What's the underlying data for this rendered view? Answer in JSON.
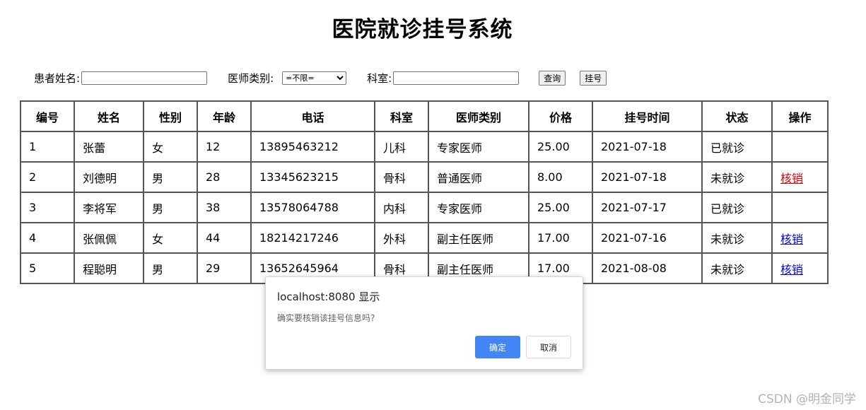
{
  "page": {
    "title": "医院就诊挂号系统"
  },
  "filters": {
    "patient_name_label": "患者姓名:",
    "patient_name_value": "",
    "doctor_type_label": "医师类别:",
    "doctor_type_selected": "=不限=",
    "department_label": "科室:",
    "department_value": "",
    "query_button": "查询",
    "register_button": "挂号"
  },
  "table": {
    "headers": [
      "编号",
      "姓名",
      "性别",
      "年龄",
      "电话",
      "科室",
      "医师类别",
      "价格",
      "挂号时间",
      "状态",
      "操作"
    ],
    "rows": [
      [
        "1",
        "张蕾",
        "女",
        "12",
        "13895463212",
        "儿科",
        "专家医师",
        "25.00",
        "2021-07-18",
        "已就诊",
        ""
      ],
      [
        "2",
        "刘德明",
        "男",
        "28",
        "13345623215",
        "骨科",
        "普通医师",
        "8.00",
        "2021-07-18",
        "未就诊",
        "核销"
      ],
      [
        "3",
        "李将军",
        "男",
        "38",
        "13578064788",
        "内科",
        "专家医师",
        "25.00",
        "2021-07-17",
        "已就诊",
        ""
      ],
      [
        "4",
        "张佩佩",
        "女",
        "44",
        "18214217246",
        "外科",
        "副主任医师",
        "17.00",
        "2021-07-16",
        "未就诊",
        "核销"
      ],
      [
        "5",
        "程聪明",
        "男",
        "29",
        "13652645964",
        "骨科",
        "副主任医师",
        "17.00",
        "2021-08-08",
        "未就诊",
        "核销"
      ]
    ]
  },
  "dialog": {
    "title": "localhost:8080 显示",
    "message": "确实要核销该挂号信息吗?",
    "ok_label": "确定",
    "cancel_label": "取消"
  },
  "watermark": "CSDN @明金同学",
  "colors": {
    "link": "#0000ee",
    "visited_link": "#e00000",
    "dialog_ok": "#4285f4"
  }
}
